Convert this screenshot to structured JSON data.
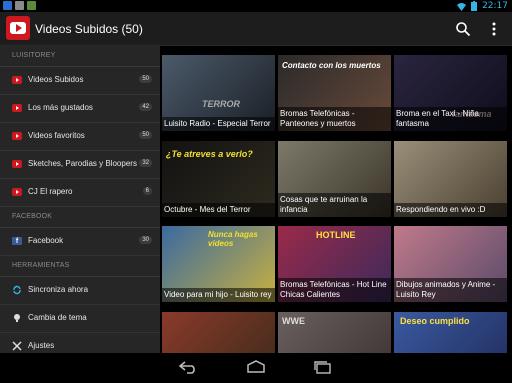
{
  "status_bar": {
    "time": "22:17"
  },
  "action_bar": {
    "title": "Videos Subidos (50)"
  },
  "drawer": {
    "sections": [
      {
        "header": "LUISITOREY",
        "items": [
          {
            "label": "Videos Subidos",
            "count": "50",
            "icon": "youtube-icon"
          },
          {
            "label": "Los más gustados",
            "count": "42",
            "icon": "youtube-icon"
          },
          {
            "label": "Videos favoritos",
            "count": "50",
            "icon": "youtube-icon"
          },
          {
            "label": "Sketches, Parodias y Bloopers",
            "count": "32",
            "icon": "youtube-icon"
          },
          {
            "label": "CJ El rapero",
            "count": "6",
            "icon": "youtube-icon"
          }
        ]
      },
      {
        "header": "FACEBOOK",
        "items": [
          {
            "label": "Facebook",
            "count": "30",
            "icon": "facebook-icon"
          }
        ]
      },
      {
        "header": "HERRAMIENTAS",
        "items": [
          {
            "label": "Sincroniza ahora",
            "icon": "sync-icon"
          },
          {
            "label": "Cambia de tema",
            "icon": "bulb-icon"
          },
          {
            "label": "Ajustes",
            "icon": "settings-icon"
          }
        ]
      }
    ]
  },
  "videos": [
    {
      "title": "Luisito Radio - Especial Terror",
      "overlay": "TERROR",
      "color1": "#4b5a6a",
      "color2": "#1b1f26"
    },
    {
      "title": "Bromas Telefónicas - Panteones y muertos",
      "overlay": "Contacto con los muertos",
      "color1": "#2a2a2a",
      "color2": "#6a4a3a"
    },
    {
      "title": "Broma en el Taxi - Niña fantasma",
      "overlay": "fantasma",
      "color1": "#2b2540",
      "color2": "#0d0d1a"
    },
    {
      "title": "Octubre - Mes del Terror",
      "overlay": "¿Te atreves a verlo?",
      "color1": "#121212",
      "color2": "#2e2a1e"
    },
    {
      "title": "Cosas que te arruinan la infancia",
      "overlay": "",
      "color1": "#7d7a6a",
      "color2": "#3a3428"
    },
    {
      "title": "Respondiendo en vivo :D",
      "overlay": "",
      "color1": "#9a8f7a",
      "color2": "#4a4030"
    },
    {
      "title": "Video para mi hijo - Luisito rey",
      "overlay": "Nunca hagas videos",
      "color1": "#3a6aa0",
      "color2": "#c8b040"
    },
    {
      "title": "Bromas Telefónicas - Hot Line Chicas Calientes",
      "overlay": "HOTLINE",
      "color1": "#9a2a4a",
      "color2": "#3a2a5a"
    },
    {
      "title": "Dibujos animados y Anime - Luisito Rey",
      "overlay": "",
      "color1": "#c07a8a",
      "color2": "#5a4a6a"
    },
    {
      "title": "",
      "overlay": "",
      "color1": "#8a3a2a",
      "color2": "#3a2a1a"
    },
    {
      "title": "",
      "overlay": "WWE",
      "color1": "#6a6060",
      "color2": "#3a3030"
    },
    {
      "title": "",
      "overlay": "Deseo cumplido",
      "color1": "#3a5aa0",
      "color2": "#202a5a"
    }
  ]
}
